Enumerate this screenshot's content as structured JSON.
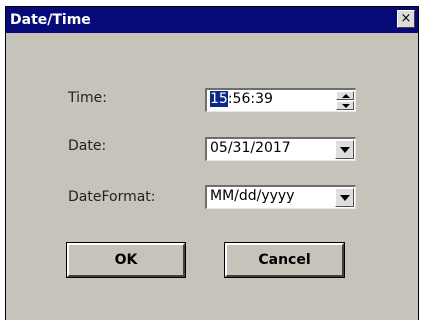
{
  "window": {
    "title": "Date/Time",
    "close_label": "×"
  },
  "form": {
    "time_label": "Time:",
    "time_value_selected": "15",
    "time_value_rest": ":56:39",
    "date_label": "Date:",
    "date_value": "05/31/2017",
    "format_label": "DateFormat:",
    "format_value": "MM/dd/yyyy"
  },
  "buttons": {
    "ok": "OK",
    "cancel": "Cancel"
  },
  "icons": {
    "close": "close-icon",
    "spin_up": "chevron-up-icon",
    "spin_down": "chevron-down-icon",
    "dropdown": "chevron-down-icon"
  },
  "colors": {
    "titlebar": "#070b7a",
    "dialog_bg": "#c6c3bb",
    "selection": "#0a2a87"
  }
}
